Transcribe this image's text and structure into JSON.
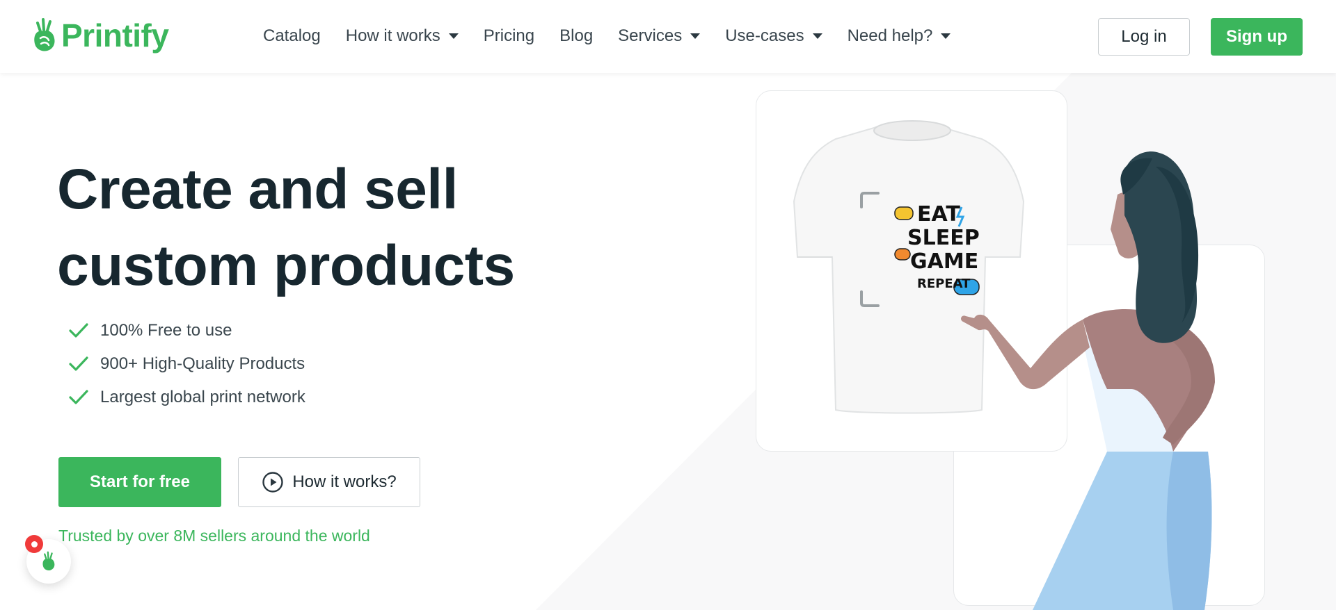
{
  "header": {
    "brand": "Printify",
    "nav": [
      {
        "label": "Catalog",
        "has_dropdown": false
      },
      {
        "label": "How it works",
        "has_dropdown": true
      },
      {
        "label": "Pricing",
        "has_dropdown": false
      },
      {
        "label": "Blog",
        "has_dropdown": false
      },
      {
        "label": "Services",
        "has_dropdown": true
      },
      {
        "label": "Use-cases",
        "has_dropdown": true
      },
      {
        "label": "Need help?",
        "has_dropdown": true
      }
    ],
    "login_label": "Log in",
    "signup_label": "Sign up"
  },
  "hero": {
    "title_line1": "Create and sell",
    "title_line2": "custom products",
    "features": [
      "100% Free to use",
      "900+ High-Quality Products",
      "Largest global print network"
    ],
    "start_label": "Start for free",
    "how_label": "How it works?",
    "trusted_text": "Trusted by over 8M sellers around the world"
  },
  "tshirt_design": {
    "lines": [
      "EAT",
      "SLEEP",
      "GAME",
      "REPEAT"
    ]
  },
  "colors": {
    "brand_green": "#3bb65c",
    "text_dark": "#17272f",
    "badge_red": "#f03a3a"
  },
  "icons": {
    "logo": "printify-hand-logo-icon",
    "check": "check-icon",
    "play": "play-circle-icon",
    "dropdown": "caret-down-icon",
    "chat": "printify-chat-icon"
  }
}
